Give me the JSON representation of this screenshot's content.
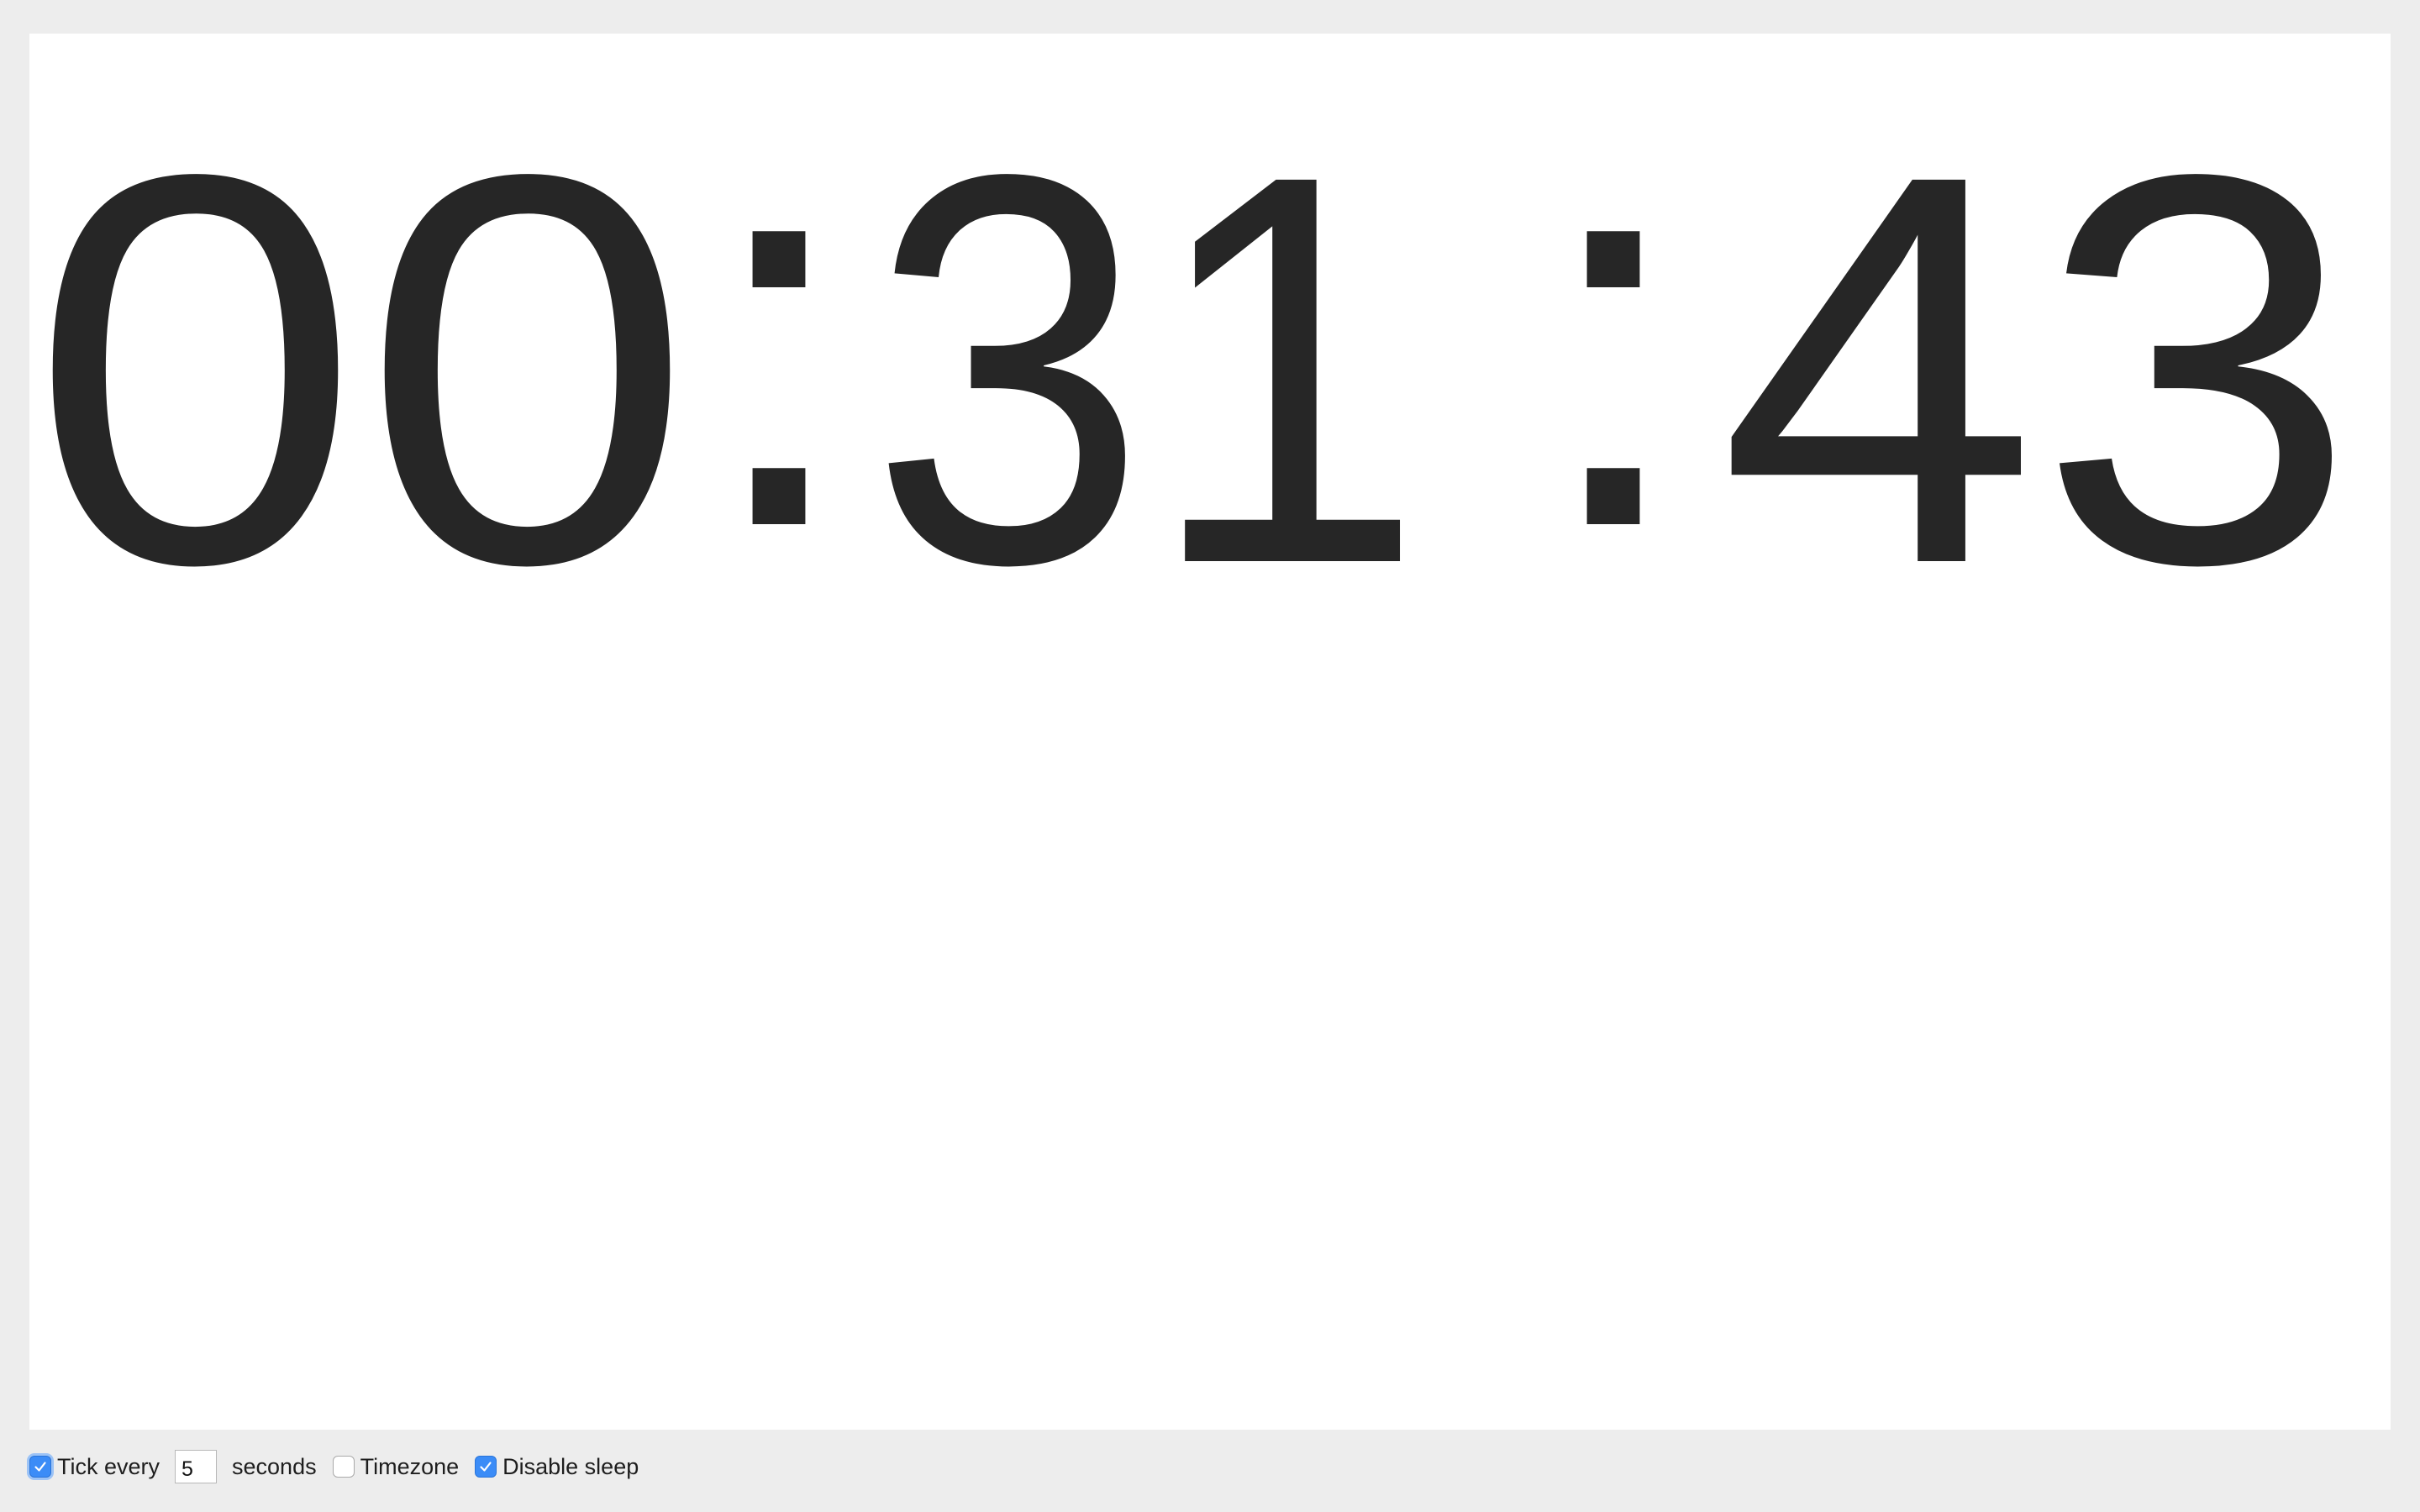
{
  "clock": {
    "hours": "00",
    "minutes": "31",
    "seconds": "43",
    "separator": ":"
  },
  "controls": {
    "tick": {
      "checked": true,
      "label_before": "Tick every",
      "interval_value": "5",
      "label_after": "seconds"
    },
    "timezone": {
      "checked": false,
      "label": "Timezone"
    },
    "disable_sleep": {
      "checked": true,
      "label": "Disable sleep"
    }
  },
  "colors": {
    "text": "#262626",
    "accent": "#3b8cf7",
    "background": "#ededed",
    "panel": "#ffffff"
  },
  "icons": {
    "checkmark": "checkmark-icon"
  }
}
